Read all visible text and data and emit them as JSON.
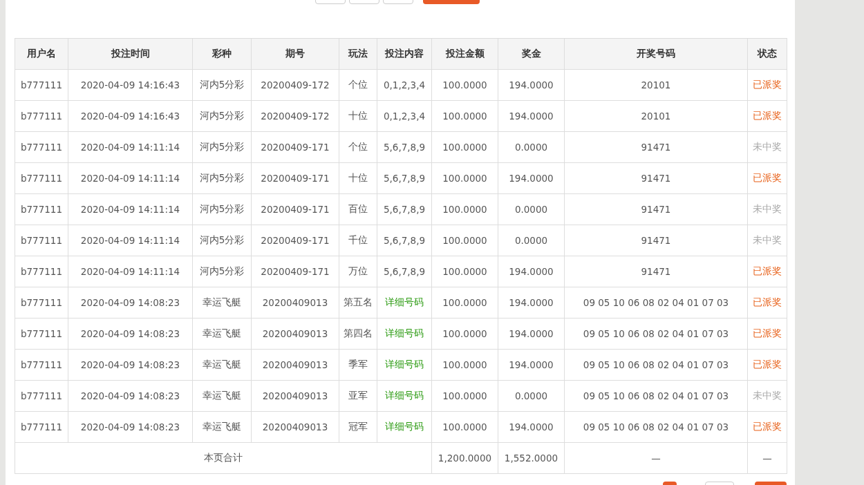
{
  "table": {
    "columns": [
      "用户名",
      "投注时间",
      "彩种",
      "期号",
      "玩法",
      "投注内容",
      "投注金额",
      "奖金",
      "开奖号码",
      "状态"
    ],
    "rows": [
      {
        "user": "b777111",
        "time": "2020-04-09 14:16:43",
        "lottery": "河内5分彩",
        "issue": "20200409-172",
        "play": "个位",
        "content": {
          "text": "0,1,2,3,4",
          "kind": "numbers"
        },
        "amount": "100.0000",
        "prize": "194.0000",
        "result": "20101",
        "status": {
          "text": "已派奖",
          "kind": "paid"
        }
      },
      {
        "user": "b777111",
        "time": "2020-04-09 14:16:43",
        "lottery": "河内5分彩",
        "issue": "20200409-172",
        "play": "十位",
        "content": {
          "text": "0,1,2,3,4",
          "kind": "numbers"
        },
        "amount": "100.0000",
        "prize": "194.0000",
        "result": "20101",
        "status": {
          "text": "已派奖",
          "kind": "paid"
        }
      },
      {
        "user": "b777111",
        "time": "2020-04-09 14:11:14",
        "lottery": "河内5分彩",
        "issue": "20200409-171",
        "play": "个位",
        "content": {
          "text": "5,6,7,8,9",
          "kind": "numbers"
        },
        "amount": "100.0000",
        "prize": "0.0000",
        "result": "91471",
        "status": {
          "text": "未中奖",
          "kind": "lost"
        }
      },
      {
        "user": "b777111",
        "time": "2020-04-09 14:11:14",
        "lottery": "河内5分彩",
        "issue": "20200409-171",
        "play": "十位",
        "content": {
          "text": "5,6,7,8,9",
          "kind": "numbers"
        },
        "amount": "100.0000",
        "prize": "194.0000",
        "result": "91471",
        "status": {
          "text": "已派奖",
          "kind": "paid"
        }
      },
      {
        "user": "b777111",
        "time": "2020-04-09 14:11:14",
        "lottery": "河内5分彩",
        "issue": "20200409-171",
        "play": "百位",
        "content": {
          "text": "5,6,7,8,9",
          "kind": "numbers"
        },
        "amount": "100.0000",
        "prize": "0.0000",
        "result": "91471",
        "status": {
          "text": "未中奖",
          "kind": "lost"
        }
      },
      {
        "user": "b777111",
        "time": "2020-04-09 14:11:14",
        "lottery": "河内5分彩",
        "issue": "20200409-171",
        "play": "千位",
        "content": {
          "text": "5,6,7,8,9",
          "kind": "numbers"
        },
        "amount": "100.0000",
        "prize": "0.0000",
        "result": "91471",
        "status": {
          "text": "未中奖",
          "kind": "lost"
        }
      },
      {
        "user": "b777111",
        "time": "2020-04-09 14:11:14",
        "lottery": "河内5分彩",
        "issue": "20200409-171",
        "play": "万位",
        "content": {
          "text": "5,6,7,8,9",
          "kind": "numbers"
        },
        "amount": "100.0000",
        "prize": "194.0000",
        "result": "91471",
        "status": {
          "text": "已派奖",
          "kind": "paid"
        }
      },
      {
        "user": "b777111",
        "time": "2020-04-09 14:08:23",
        "lottery": "幸运飞艇",
        "issue": "20200409013",
        "play": "第五名",
        "content": {
          "text": "详细号码",
          "kind": "link"
        },
        "amount": "100.0000",
        "prize": "194.0000",
        "result": "09 05 10 06 08 02 04 01 07 03",
        "status": {
          "text": "已派奖",
          "kind": "paid"
        }
      },
      {
        "user": "b777111",
        "time": "2020-04-09 14:08:23",
        "lottery": "幸运飞艇",
        "issue": "20200409013",
        "play": "第四名",
        "content": {
          "text": "详细号码",
          "kind": "link"
        },
        "amount": "100.0000",
        "prize": "194.0000",
        "result": "09 05 10 06 08 02 04 01 07 03",
        "status": {
          "text": "已派奖",
          "kind": "paid"
        }
      },
      {
        "user": "b777111",
        "time": "2020-04-09 14:08:23",
        "lottery": "幸运飞艇",
        "issue": "20200409013",
        "play": "季军",
        "content": {
          "text": "详细号码",
          "kind": "link"
        },
        "amount": "100.0000",
        "prize": "194.0000",
        "result": "09 05 10 06 08 02 04 01 07 03",
        "status": {
          "text": "已派奖",
          "kind": "paid"
        }
      },
      {
        "user": "b777111",
        "time": "2020-04-09 14:08:23",
        "lottery": "幸运飞艇",
        "issue": "20200409013",
        "play": "亚军",
        "content": {
          "text": "详细号码",
          "kind": "link"
        },
        "amount": "100.0000",
        "prize": "0.0000",
        "result": "09 05 10 06 08 02 04 01 07 03",
        "status": {
          "text": "未中奖",
          "kind": "lost"
        }
      },
      {
        "user": "b777111",
        "time": "2020-04-09 14:08:23",
        "lottery": "幸运飞艇",
        "issue": "20200409013",
        "play": "冠军",
        "content": {
          "text": "详细号码",
          "kind": "link"
        },
        "amount": "100.0000",
        "prize": "194.0000",
        "result": "09 05 10 06 08 02 04 01 07 03",
        "status": {
          "text": "已派奖",
          "kind": "paid"
        }
      }
    ],
    "total": {
      "label": "本页合计",
      "amount": "1,200.0000",
      "prize": "1,552.0000",
      "result": "—",
      "status": "—"
    }
  }
}
